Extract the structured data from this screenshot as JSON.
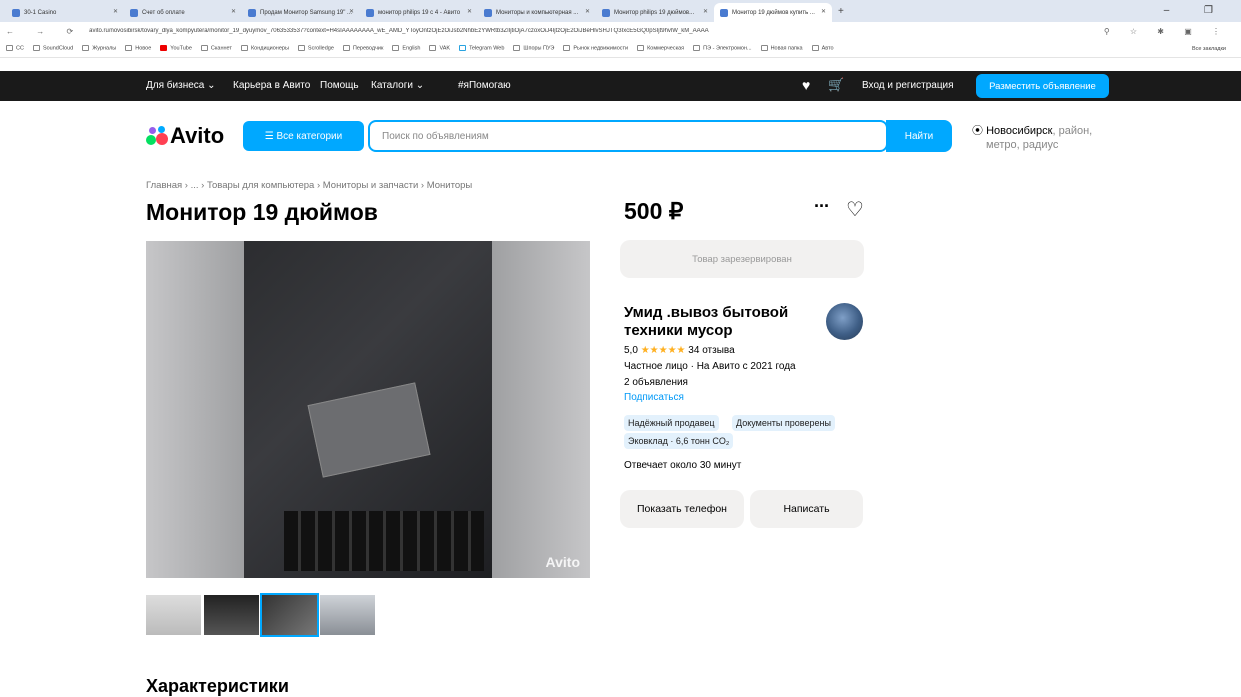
{
  "browser": {
    "tabs": [
      {
        "title": "30-1 Casino"
      },
      {
        "title": "Счет об оплате"
      },
      {
        "title": "Продам Монитор Samsung 19\" ..."
      },
      {
        "title": "монитор philips 19 с 4 - Авито"
      },
      {
        "title": "Мониторы и компьютерная ..."
      },
      {
        "title": "Монитор philips 19 дюймов..."
      },
      {
        "title": "Монитор 19 дюймов купить ..."
      }
    ],
    "window_controls": "–  ❐",
    "nav_icons": "← → ⟳",
    "url": "avito.ru/novosibirsk/tovary_dlya_kompyutera/monitor_19_dyuymov_7063533537?context=H4sIAAAAAAAA_wE_AMD_YToyOntzOjEzOiJsb2NhbEzYWRtb3ZlIjtiOjA7czoxOiJ4IjtzOjE2OiJBeHlvSHJTQ3IxcE5GQ0pSIjt9hvlW_kM_AAAA",
    "toolbar_icons": "⚲ ☆ ✱ ▣ ⋮",
    "bookmarks": [
      "CC",
      "SoundCloud",
      "Журналы",
      "Новое",
      "YouTube",
      "Сканнет",
      "Кондиционеры",
      "Scrolledge",
      "Переводчик",
      "English",
      "VAK",
      "Telegram Web",
      "Шпоры ПУЭ",
      "Рынок недвижимости",
      "Коммерческая",
      "ПЭ - Электромон...",
      "Новая папка",
      "Авто"
    ],
    "bookmarks_right": "Все закладки"
  },
  "topnav": {
    "items": [
      "Для бизнеса ⌄",
      "Карьера в Авито",
      "Помощь",
      "Каталоги ⌄",
      "#яПомогаю"
    ],
    "login": "Вход и регистрация",
    "post_button": "Разместить объявление"
  },
  "header": {
    "logo_text": "Avito",
    "categories_button": "☰  Все категории",
    "search_placeholder": "Поиск по объявлениям",
    "search_button": "Найти",
    "location_city": "Новосибирск",
    "location_rest1": ", район,",
    "location_rest2": "метро, радиус"
  },
  "breadcrumbs": "Главная  ›  ...  ›  Товары для компьютера  ›  Мониторы и запчасти  ›  Мониторы",
  "listing": {
    "title": "Монитор 19 дюймов",
    "price": "500 ₽",
    "more_icon": "···",
    "reserved": "Товар зарезервирован",
    "image_watermark": "Avito",
    "thumbnails": 4
  },
  "seller": {
    "name": "Умид .вывоз бытовой техники мусор",
    "rating": "5,0",
    "stars": "★★★★★",
    "reviews": "34 отзыва",
    "info": "Частное лицо · На Авито с 2021 года",
    "listings": "2 объявления",
    "subscribe": "Подписаться",
    "badges": [
      "Надёжный продавец",
      "Документы проверены",
      "Эковклад · 6,6 тонн CO₂"
    ],
    "response": "Отвечает около 30 минут",
    "show_phone": "Показать телефон",
    "write": "Написать"
  },
  "section_title": "Характеристики",
  "colors": {
    "accent": "#00a8ff",
    "dark": "#1a1a1a",
    "star": "#ffb021"
  }
}
